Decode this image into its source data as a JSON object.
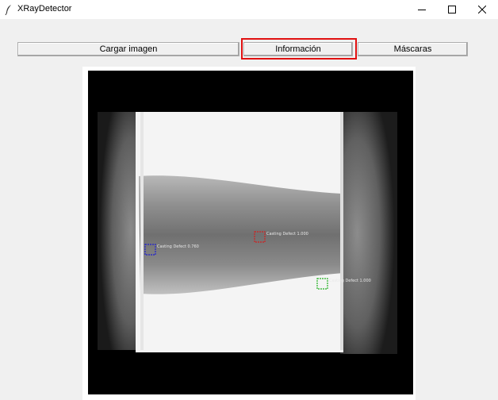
{
  "window": {
    "title": "XRayDetector",
    "app_icon": "feather-icon",
    "controls": [
      "minimize-icon",
      "maximize-icon",
      "close-icon"
    ]
  },
  "toolbar": {
    "load_label": "Cargar imagen",
    "info_label": "Información",
    "masks_label": "Máscaras",
    "highlight_color": "#e01010"
  },
  "image": {
    "detections": [
      {
        "label": "Casting Defect 0.760",
        "color": "#2020d0"
      },
      {
        "label": "Casting Defect 1.000",
        "color": "#d02020"
      },
      {
        "label": "Casting Defect 1.000",
        "color": "#20b020"
      }
    ]
  }
}
